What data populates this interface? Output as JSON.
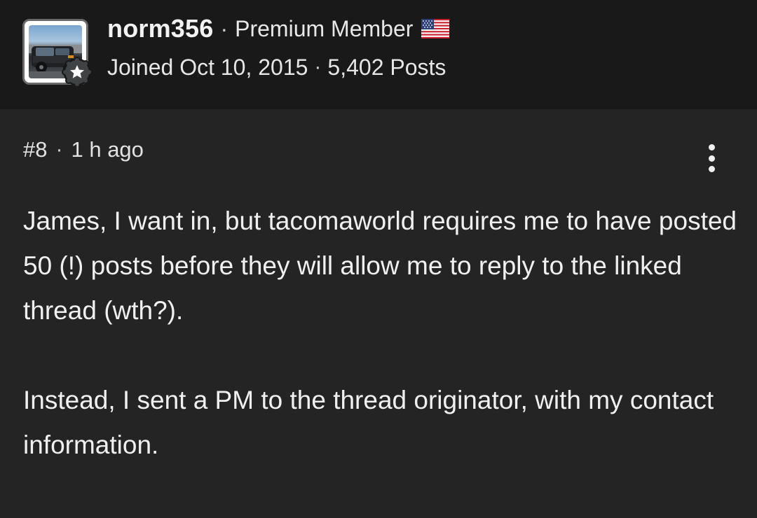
{
  "author": {
    "username": "norm356",
    "member_type": "Premium Member",
    "country_flag": "us-flag-icon",
    "joined": "Joined Oct 10, 2015",
    "posts": "5,402 Posts",
    "avatar": "avatar-truck-image",
    "badge": "star-badge-icon"
  },
  "post": {
    "number": "#8",
    "time": "1 h ago",
    "menu_icon": "more-vertical-icon",
    "paragraphs": [
      "James, I want in, but tacomaworld requires me to have posted 50 (!) posts before they will allow me to reply to the linked thread (wth?).",
      "Instead, I sent a PM to the thread originator, with my contact information."
    ]
  },
  "separator": "·",
  "colors": {
    "header_bg": "#191919",
    "body_bg": "#242424",
    "text": "#f0f0f0"
  }
}
